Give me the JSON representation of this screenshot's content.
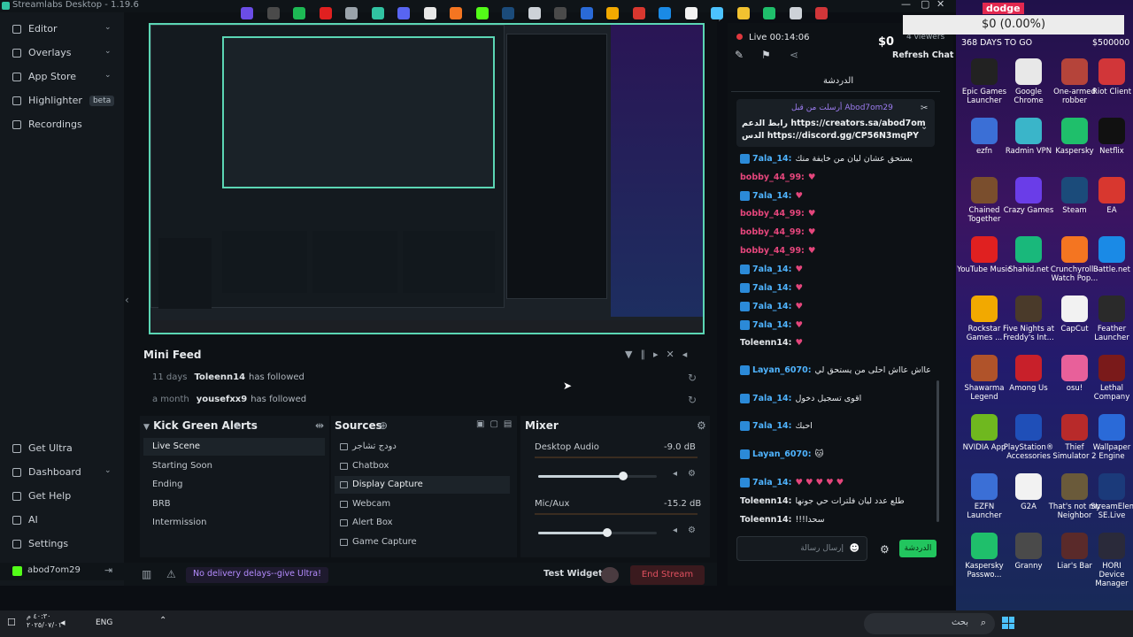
{
  "window": {
    "title": "Streamlabs Desktop - 1.19.6"
  },
  "sidebar": {
    "top_items": [
      {
        "label": "Editor",
        "icon": "editor-icon",
        "chevron": true
      },
      {
        "label": "Overlays",
        "icon": "overlays-icon",
        "chevron": true
      },
      {
        "label": "App Store",
        "icon": "app-store-icon",
        "chevron": true
      },
      {
        "label": "Highlighter",
        "icon": "highlighter-icon",
        "chevron": false,
        "badge": "beta"
      },
      {
        "label": "Recordings",
        "icon": "recordings-icon",
        "chevron": false
      }
    ],
    "bottom_items": [
      {
        "label": "Get Ultra",
        "icon": "ultra-icon"
      },
      {
        "label": "Dashboard",
        "icon": "dashboard-icon",
        "chevron": true
      },
      {
        "label": "Get Help",
        "icon": "help-icon"
      },
      {
        "label": "AI",
        "icon": "ai-icon"
      },
      {
        "label": "Settings",
        "icon": "settings-icon"
      }
    ],
    "user": "abod7om29"
  },
  "minifeed": {
    "title": "Mini Feed",
    "rows": [
      {
        "time": "11 days",
        "user": "Toleenn14",
        "text": "has followed"
      },
      {
        "time": "a month",
        "user": "yousefxx9",
        "text": "has followed"
      }
    ]
  },
  "scenes": {
    "title": "Kick Green Alerts",
    "items": [
      "Live Scene",
      "Starting Soon",
      "Ending",
      "BRB",
      "Intermission"
    ],
    "active": "Live Scene"
  },
  "sources": {
    "title": "Sources",
    "items": [
      "دودج تشاجر",
      "Chatbox",
      "Display Capture",
      "Webcam",
      "Alert Box",
      "Game Capture"
    ],
    "active": "Display Capture"
  },
  "mixer": {
    "title": "Mixer",
    "channels": [
      {
        "name": "Desktop Audio",
        "db": "-9.0 dB",
        "level": 0.72
      },
      {
        "name": "Mic/Aux",
        "db": "-15.2 dB",
        "level": 0.58
      }
    ]
  },
  "footer": {
    "ultra_text": "No delivery delays--give Ultra!",
    "test_widgets": "Test Widgets",
    "end_stream": "End Stream"
  },
  "stream": {
    "live_time": "Live 00:14:06",
    "viewers": "4 viewers",
    "refresh_chat": "Refresh Chat",
    "chat_title": "الدردشة",
    "dollar": "$0"
  },
  "pinned": {
    "user": "Abod7om29",
    "line1": "رابط الدعم https://creators.sa/abod7om",
    "line2": "الدس https://discord.gg/CP56N3mqPY",
    "header": "أرسلت من قبل"
  },
  "chat": [
    {
      "user": "7ala_14:",
      "text": "يستحق عشان ليان من خايفة منك",
      "color": "#4fb4ff"
    },
    {
      "user": "bobby_44_99:",
      "text": "♥",
      "color": "#e5467c"
    },
    {
      "user": "7ala_14:",
      "text": "♥",
      "color": "#4fb4ff"
    },
    {
      "user": "bobby_44_99:",
      "text": "♥",
      "color": "#e5467c"
    },
    {
      "user": "bobby_44_99:",
      "text": "♥",
      "color": "#e5467c"
    },
    {
      "user": "bobby_44_99:",
      "text": "♥",
      "color": "#e5467c"
    },
    {
      "user": "7ala_14:",
      "text": "♥",
      "color": "#4fb4ff"
    },
    {
      "user": "7ala_14:",
      "text": "♥",
      "color": "#4fb4ff"
    },
    {
      "user": "7ala_14:",
      "text": "♥",
      "color": "#4fb4ff"
    },
    {
      "user": "7ala_14:",
      "text": "♥",
      "color": "#4fb4ff"
    },
    {
      "user": "Toleenn14:",
      "text": "♥",
      "color": "#e4e7ea"
    },
    {
      "user": "Layan_6070:",
      "text": "عااش عااش احلى من يستحق لي",
      "color": "#4fb4ff"
    },
    {
      "user": "7ala_14:",
      "text": "اقوى تسجيل دخول",
      "color": "#4fb4ff"
    },
    {
      "user": "7ala_14:",
      "text": "احبك",
      "color": "#4fb4ff"
    },
    {
      "user": "Layan_6070:",
      "text": "🐱",
      "color": "#4fb4ff"
    },
    {
      "user": "7ala_14:",
      "text": "♥ ♥ ♥ ♥ ♥",
      "color": "#4fb4ff"
    },
    {
      "user": "Toleenn14:",
      "text": "طلع عدد ليان فلترات حي جونها",
      "color": "#e4e7ea"
    },
    {
      "user": "Toleenn14:",
      "text": "!!!سحدا",
      "color": "#e4e7ea"
    }
  ],
  "chat_input": {
    "placeholder": "إرسال رسالة",
    "send": "الدردشة"
  },
  "overlay": {
    "sum": "$0 (0.00%)",
    "days": "368 DAYS TO GO",
    "amount": "$500000",
    "tag": "dodge"
  },
  "desktop_icons": [
    {
      "label": "Epic Games Launcher",
      "color": "#222222"
    },
    {
      "label": "Google Chrome",
      "color": "#e8e8e8"
    },
    {
      "label": "One-armed robber",
      "color": "#b5443a"
    },
    {
      "label": "Riot Client",
      "color": "#d13639"
    },
    {
      "label": "ezfn",
      "color": "#3b6fd6"
    },
    {
      "label": "Radmin VPN",
      "color": "#3ab5c9"
    },
    {
      "label": "Kaspersky",
      "color": "#1fbf6b"
    },
    {
      "label": "Netflix",
      "color": "#111111"
    },
    {
      "label": "Chained Together",
      "color": "#7a4e2d"
    },
    {
      "label": "Crazy Games",
      "color": "#6a3de8"
    },
    {
      "label": "Steam",
      "color": "#1b4b7a"
    },
    {
      "label": "EA",
      "color": "#d8372f"
    },
    {
      "label": "YouTube Music",
      "color": "#e02020"
    },
    {
      "label": "Shahid.net",
      "color": "#19b87b"
    },
    {
      "label": "Crunchyroll - Watch Pop...",
      "color": "#f47521"
    },
    {
      "label": "Battle.net",
      "color": "#1a8ae6"
    },
    {
      "label": "Rockstar Games ...",
      "color": "#f2a900"
    },
    {
      "label": "Five Nights at Freddy's Int...",
      "color": "#4a3a2a"
    },
    {
      "label": "CapCut",
      "color": "#f2f2f2"
    },
    {
      "label": "Feather Launcher",
      "color": "#2a2a2a"
    },
    {
      "label": "Shawarma Legend",
      "color": "#b0532a"
    },
    {
      "label": "Among Us",
      "color": "#c8202a"
    },
    {
      "label": "osu!",
      "color": "#e8609a"
    },
    {
      "label": "Lethal Company",
      "color": "#7a1a1a"
    },
    {
      "label": "NVIDIA App",
      "color": "#6fb81f"
    },
    {
      "label": "PlayStation® Accessories",
      "color": "#1f4fb8"
    },
    {
      "label": "Thief Simulator 2",
      "color": "#b82a2a"
    },
    {
      "label": "Wallpaper Engine",
      "color": "#2a6ad8"
    },
    {
      "label": "EZFN Launcher",
      "color": "#3b6fd6"
    },
    {
      "label": "G2A",
      "color": "#f2f2f2"
    },
    {
      "label": "That's not my Neighbor",
      "color": "#6a5a3a"
    },
    {
      "label": "StreamElements SE.Live",
      "color": "#1b3a7a"
    },
    {
      "label": "Kaspersky Passwo...",
      "color": "#1fbf6b"
    },
    {
      "label": "Granny",
      "color": "#4a4a4a"
    },
    {
      "label": "Liar's Bar",
      "color": "#5a2a2a"
    },
    {
      "label": "HORI Device Manager",
      "color": "#2a2a3a"
    }
  ],
  "taskbar": {
    "lang": "ENG",
    "search": "بحث",
    "time": "٤٠:٣٠ م",
    "date": "٢٠٢٥/٠٧/٠١"
  }
}
